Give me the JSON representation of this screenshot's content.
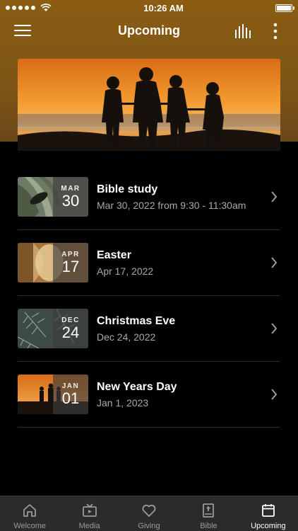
{
  "status_bar": {
    "time": "10:26 AM"
  },
  "header": {
    "title": "Upcoming"
  },
  "events": [
    {
      "title": "Bible study",
      "subtitle": "Mar 30, 2022 from 9:30 - 11:30am",
      "month": "MAR",
      "day": "30",
      "thumb": "plant"
    },
    {
      "title": "Easter",
      "subtitle": "Apr 17, 2022",
      "month": "APR",
      "day": "17",
      "thumb": "stone"
    },
    {
      "title": "Christmas Eve",
      "subtitle": "Dec 24, 2022",
      "month": "DEC",
      "day": "24",
      "thumb": "pine"
    },
    {
      "title": "New Years Day",
      "subtitle": "Jan 1, 2023",
      "month": "JAN",
      "day": "01",
      "thumb": "sunset"
    }
  ],
  "tabs": [
    {
      "label": "Welcome",
      "icon": "home-icon"
    },
    {
      "label": "Media",
      "icon": "tv-icon"
    },
    {
      "label": "Giving",
      "icon": "heart-icon"
    },
    {
      "label": "Bible",
      "icon": "bible-icon"
    },
    {
      "label": "Upcoming",
      "icon": "calendar-icon",
      "active": true
    }
  ],
  "colors": {
    "header_gradient": "#8a5d12",
    "tab_bar": "#2b2b2b",
    "subtitle": "#a8a8a8"
  }
}
